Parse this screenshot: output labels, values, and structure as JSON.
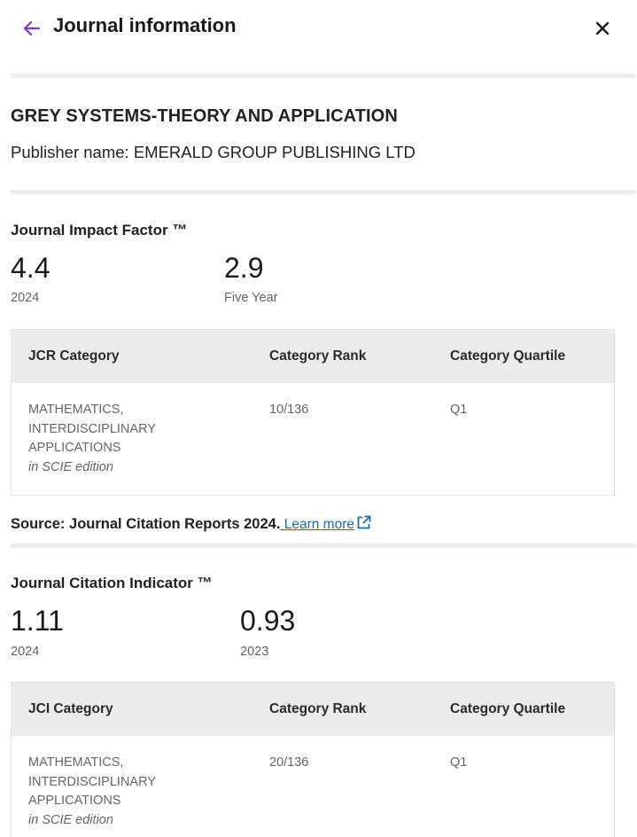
{
  "header": {
    "title": "Journal information"
  },
  "journal": {
    "name": "GREY SYSTEMS-THEORY AND APPLICATION",
    "publisher": "Publisher name: EMERALD GROUP PUBLISHING LTD"
  },
  "jif": {
    "heading": "Journal Impact Factor ™",
    "metrics": [
      {
        "value": "4.4",
        "label": "2024"
      },
      {
        "value": "2.9",
        "label": "Five Year"
      }
    ],
    "table": {
      "headers": [
        "JCR Category",
        "Category Rank",
        "Category Quartile"
      ],
      "rows": [
        {
          "category": [
            "MATHEMATICS,",
            "INTERDISCIPLINARY",
            "APPLICATIONS"
          ],
          "edition": "in SCIE edition",
          "rank": "10/136",
          "quartile": "Q1"
        }
      ]
    }
  },
  "source": {
    "text": "Source: Journal Citation Reports  2024.",
    "link": " Learn more"
  },
  "jci": {
    "heading": "Journal Citation Indicator ™",
    "metrics": [
      {
        "value": "1.11",
        "label": "2024"
      },
      {
        "value": "0.93",
        "label": "2023"
      }
    ],
    "table": {
      "headers": [
        "JCI Category",
        "Category Rank",
        "Category Quartile"
      ],
      "rows": [
        {
          "category": [
            "MATHEMATICS,",
            "INTERDISCIPLINARY",
            "APPLICATIONS"
          ],
          "edition": "in SCIE edition",
          "rank": "20/136",
          "quartile": "Q1"
        }
      ]
    }
  },
  "colors": {
    "accent": "#6b3fc7",
    "link": "#1a6da8",
    "divider": "#ececec",
    "table_header_bg": "#ececec"
  },
  "icons": {
    "back": "arrow-left-icon",
    "close": "close-icon",
    "external": "external-link-icon"
  }
}
